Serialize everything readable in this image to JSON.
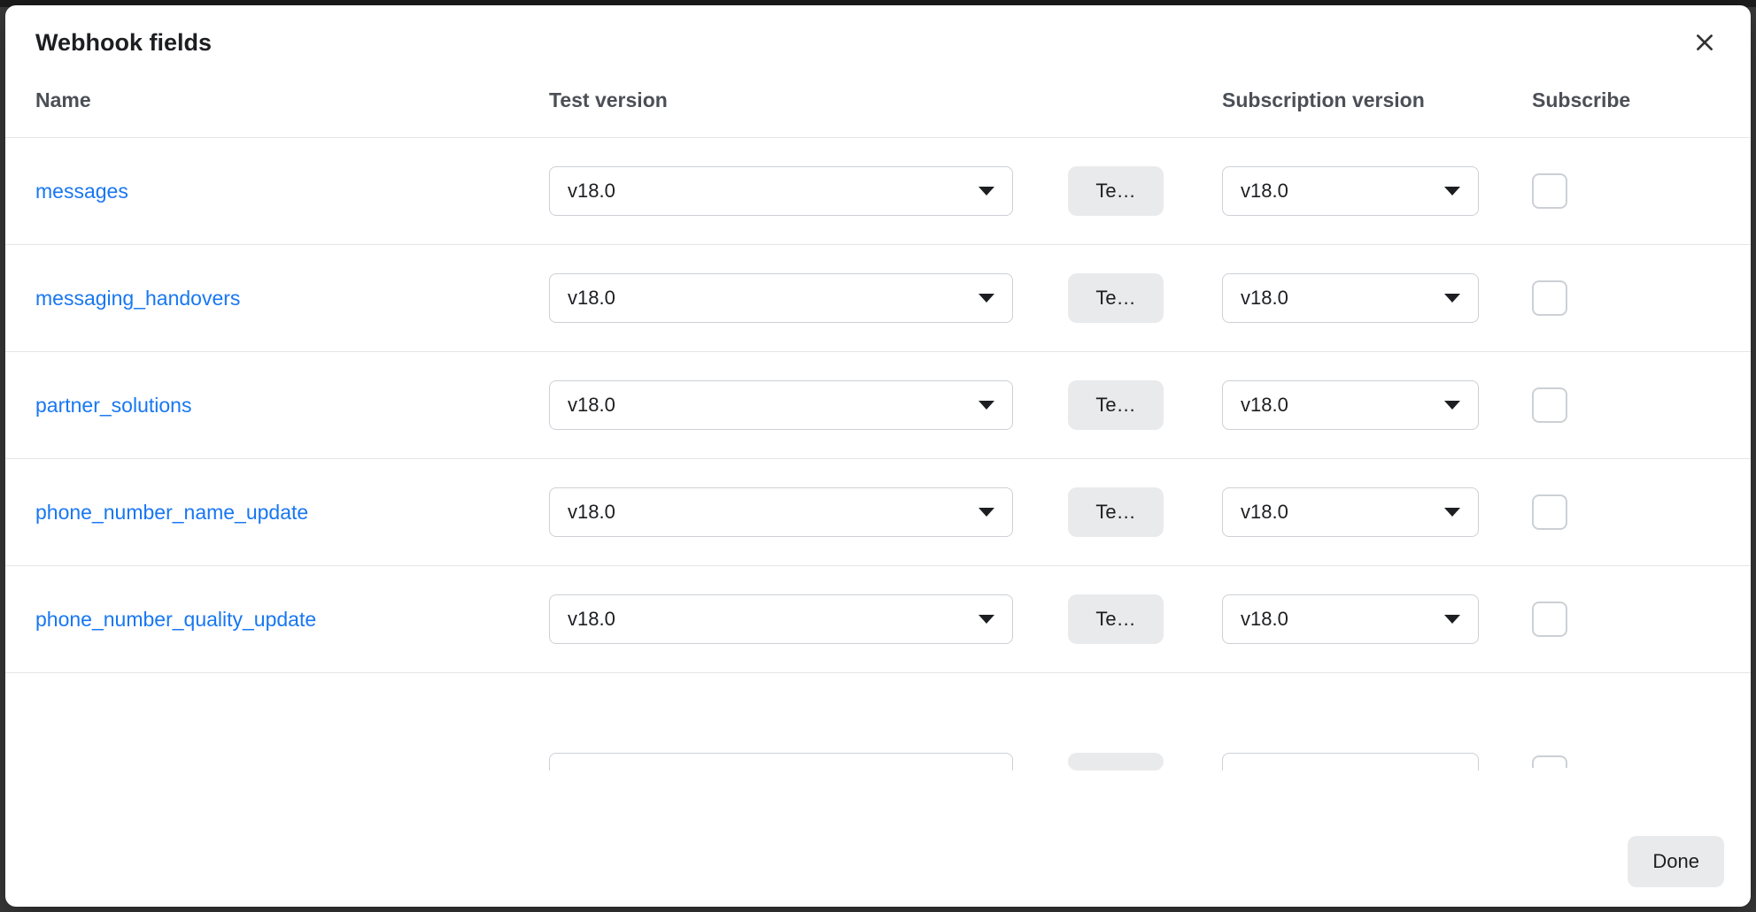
{
  "modal": {
    "title": "Webhook fields",
    "done_label": "Done"
  },
  "columns": {
    "name": "Name",
    "test_version": "Test version",
    "subscription_version": "Subscription version",
    "subscribe": "Subscribe"
  },
  "test_button_label": "Te…",
  "rows": [
    {
      "name": "messages",
      "test_version": "v18.0",
      "subscription_version": "v18.0",
      "subscribed": true
    },
    {
      "name": "messaging_handovers",
      "test_version": "v18.0",
      "subscription_version": "v18.0",
      "subscribed": false
    },
    {
      "name": "partner_solutions",
      "test_version": "v18.0",
      "subscription_version": "v18.0",
      "subscribed": false
    },
    {
      "name": "phone_number_name_update",
      "test_version": "v18.0",
      "subscription_version": "v18.0",
      "subscribed": true
    },
    {
      "name": "phone_number_quality_update",
      "test_version": "v18.0",
      "subscription_version": "v18.0",
      "subscribed": false
    }
  ]
}
